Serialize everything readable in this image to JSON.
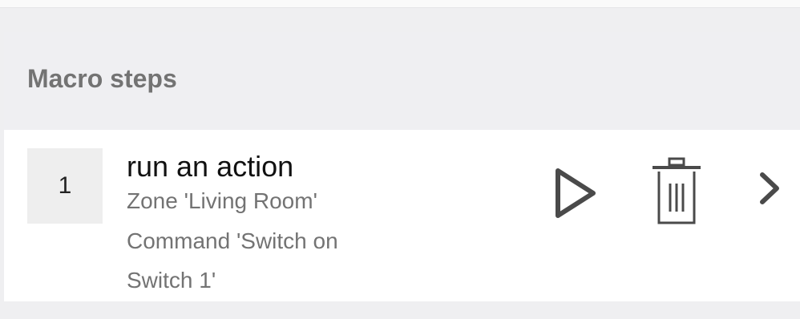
{
  "section": {
    "title": "Macro steps"
  },
  "steps": [
    {
      "number": "1",
      "title": "run an action",
      "details": [
        "Zone 'Living Room'",
        "Command 'Switch on",
        "Switch 1'"
      ]
    }
  ],
  "icons": {
    "play": "play-icon",
    "delete": "trash-icon",
    "open": "chevron-right-icon"
  },
  "colors": {
    "icon": "#4a4a4a",
    "header_background": "#efeff2",
    "row_background": "#ffffff",
    "number_background": "#eeeeee",
    "muted_text": "#737373"
  }
}
